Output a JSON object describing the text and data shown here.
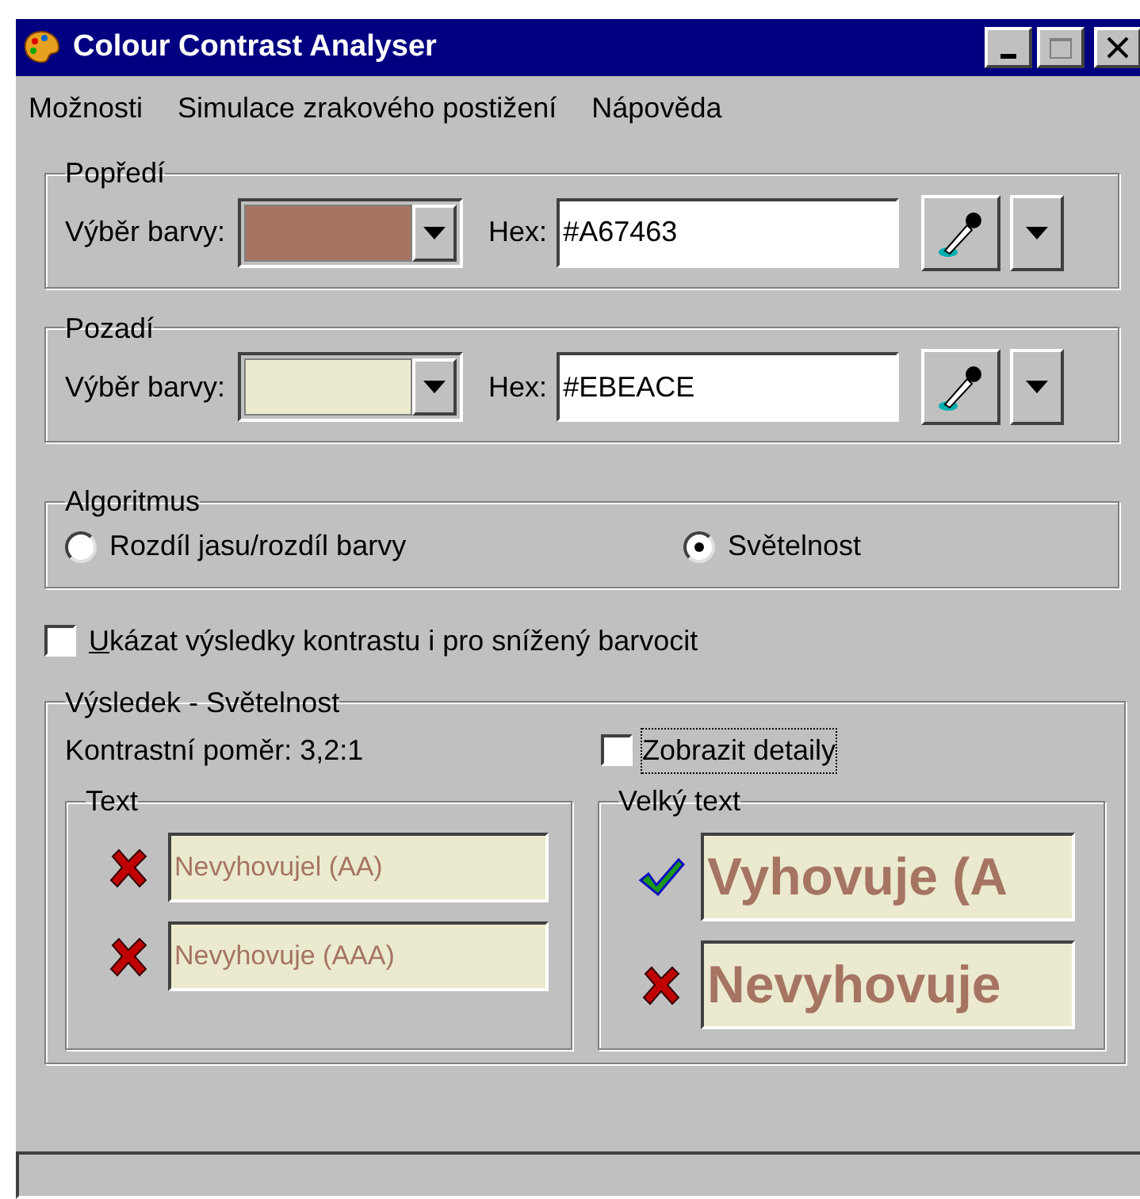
{
  "window": {
    "title": "Colour Contrast Analyser"
  },
  "menu": [
    "Možnosti",
    "Simulace zrakového postižení",
    "Nápověda"
  ],
  "colour_groups": [
    {
      "title": "Popředí",
      "picker_label": "Výběr barvy:",
      "color": "#a67463",
      "hex_label": "Hex:",
      "hex_value": "#A67463"
    },
    {
      "title": "Pozadí",
      "picker_label": "Výběr barvy:",
      "color": "#ebeace",
      "hex_label": "Hex:",
      "hex_value": "#EBEACE"
    }
  ],
  "algorithm": {
    "title": "Algoritmus",
    "options": [
      {
        "label": "Rozdíl jasu/rozdíl barvy",
        "selected": false
      },
      {
        "label": "Světelnost",
        "selected": true
      }
    ]
  },
  "colourblind_checkbox": {
    "label": "Ukázat výsledky kontrastu i pro snížený barvocit",
    "checked": false
  },
  "result": {
    "title": "Výsledek - Světelnost",
    "ratio": "Kontrastní poměr: 3,2:1",
    "details_checkbox": {
      "label": "Zobrazit detaily",
      "checked": false,
      "focused": true
    },
    "panels": [
      {
        "title": "Text",
        "large": false,
        "items": [
          {
            "text": "Nevyhovujel (AA)",
            "pass": false
          },
          {
            "text": "Nevyhovuje (AAA)",
            "pass": false
          }
        ]
      },
      {
        "title": "Velký text",
        "large": true,
        "items": [
          {
            "text": "Vyhovuje (A",
            "pass": true
          },
          {
            "text": "Nevyhovuje",
            "pass": false
          }
        ]
      }
    ]
  }
}
